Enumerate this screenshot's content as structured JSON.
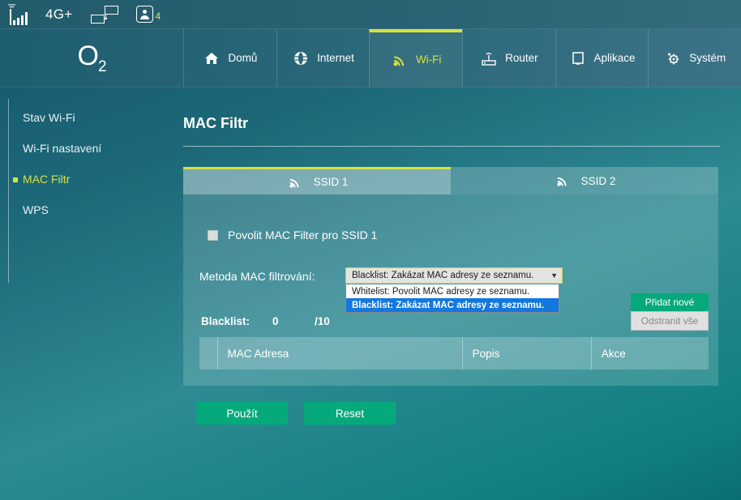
{
  "statusbar": {
    "signal_icon": "signal-bars-icon",
    "network_label": "4G+",
    "lan_icon": "network-nodes-icon",
    "user_icon": "connected-users-icon",
    "user_count": "4"
  },
  "brand": {
    "name": "O",
    "sub": "2"
  },
  "topnav": {
    "items": [
      {
        "label": "Domů",
        "icon": "home-icon",
        "active": false
      },
      {
        "label": "Internet",
        "icon": "globe-icon",
        "active": false
      },
      {
        "label": "Wi-Fi",
        "icon": "wifi-icon",
        "active": true
      },
      {
        "label": "Router",
        "icon": "router-icon",
        "active": false
      },
      {
        "label": "Aplikace",
        "icon": "monitor-icon",
        "active": false
      },
      {
        "label": "Systém",
        "icon": "gear-icon",
        "active": false
      }
    ]
  },
  "sidebar": {
    "items": [
      {
        "label": "Stav Wi-Fi",
        "active": false
      },
      {
        "label": "Wi-Fi nastavení",
        "active": false
      },
      {
        "label": "MAC Filtr",
        "active": true
      },
      {
        "label": "WPS",
        "active": false
      }
    ]
  },
  "page": {
    "title": "MAC Filtr"
  },
  "tabs": [
    {
      "label": "SSID 1",
      "icon": "wifi-icon",
      "active": true
    },
    {
      "label": "SSID 2",
      "icon": "wifi-icon",
      "active": false
    }
  ],
  "enable_filter": {
    "label": "Povolit MAC Filter pro SSID 1",
    "checked": false
  },
  "method": {
    "label": "Metoda MAC filtrování:",
    "selected": "Blacklist: Zakázat MAC adresy ze seznamu.",
    "caret": "▼",
    "open": true,
    "options": [
      {
        "label": "Whitelist: Povolit MAC adresy ze seznamu.",
        "selected": false
      },
      {
        "label": "Blacklist: Zakázat MAC adresy ze seznamu.",
        "selected": true
      }
    ]
  },
  "list": {
    "name_label": "Blacklist:",
    "count": "0",
    "max": "/10",
    "add_label": "Přidat nové",
    "delete_all_label": "Odstranit vše"
  },
  "table": {
    "columns": [
      "",
      "MAC Adresa",
      "Popis",
      "Akce"
    ],
    "rows": []
  },
  "footer": {
    "apply_label": "Použít",
    "reset_label": "Reset"
  },
  "colors": {
    "accent_yellow": "#d7e23f",
    "green_button": "#06a97b",
    "highlight_blue": "#1277e0"
  }
}
